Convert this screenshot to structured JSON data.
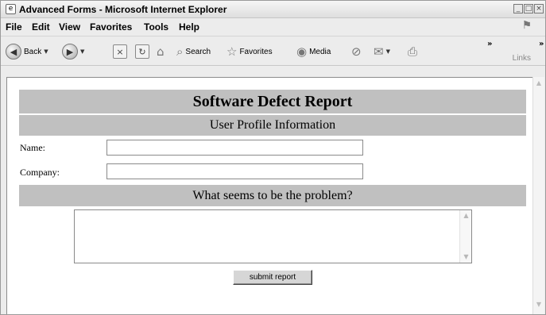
{
  "window": {
    "title": "Advanced Forms - Microsoft Internet Explorer",
    "icon": "ie-page-icon",
    "controls": [
      "minimize-icon",
      "maximize-icon",
      "close-icon"
    ]
  },
  "menu": {
    "items": [
      "File",
      "Edit",
      "View",
      "Favorites",
      "Tools",
      "Help"
    ]
  },
  "toolbar": {
    "back_label": "Back",
    "search_label": "Search",
    "favorites_label": "Favorites",
    "media_label": "Media",
    "overflow_glyph": "»",
    "links_label": "Links"
  },
  "page": {
    "title": "Software Defect Report",
    "section_profile": "User Profile Information",
    "name_label": "Name:",
    "name_value": "",
    "company_label": "Company:",
    "company_value": "",
    "section_problem": "What seems to be the problem?",
    "problem_value": "",
    "submit_label": "submit report"
  },
  "colors": {
    "band_background": "#c0c0c0",
    "chrome_background": "#ececec"
  }
}
